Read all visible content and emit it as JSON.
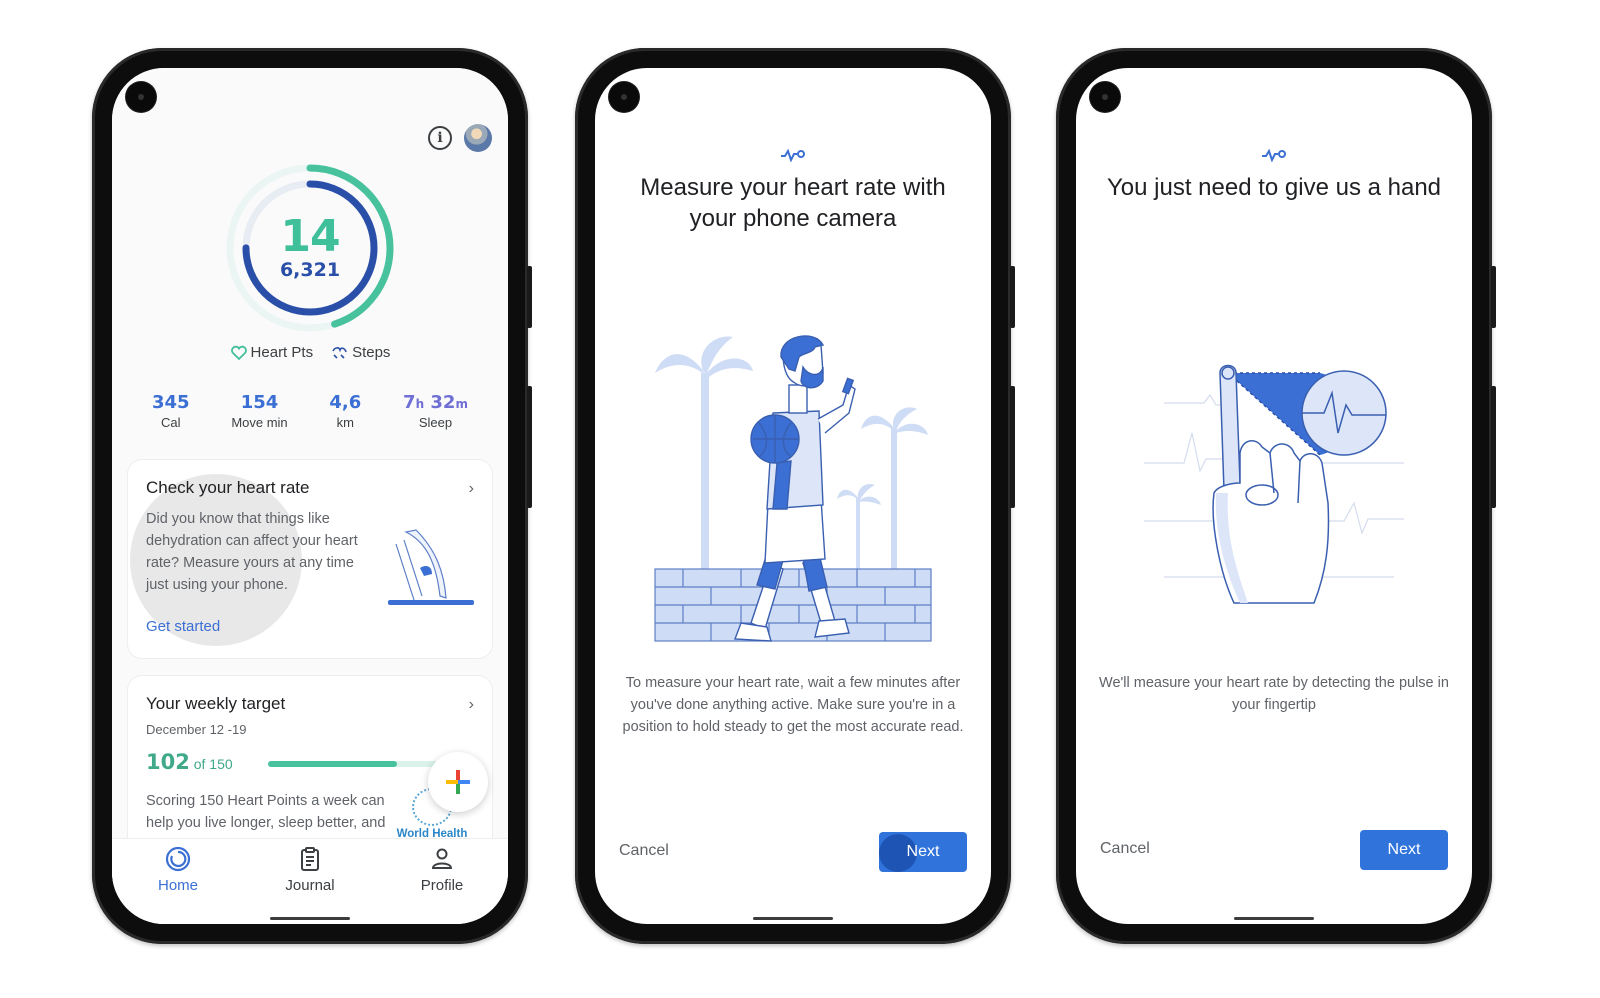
{
  "colors": {
    "heart_pts": "#3fbf9a",
    "steps": "#2a4fa8",
    "accent_blue": "#2f73db",
    "link_blue": "#3b6fd4"
  },
  "phone1": {
    "top_icons": [
      "info-icon",
      "avatar"
    ],
    "rings": {
      "heart_points": 14,
      "steps": "6,321",
      "heart_points_progress": 0.45,
      "steps_progress": 0.75
    },
    "legend": [
      {
        "icon": "heart-icon",
        "label": "Heart Pts"
      },
      {
        "icon": "steps-icon",
        "label": "Steps"
      }
    ],
    "stats": [
      {
        "value": "345",
        "label": "Cal"
      },
      {
        "value": "154",
        "label": "Move min"
      },
      {
        "value": "4,6",
        "label": "km"
      },
      {
        "hours": "7",
        "hours_unit": "h",
        "minutes": "32",
        "minutes_unit": "m",
        "label": "Sleep"
      }
    ],
    "heart_rate_card": {
      "title": "Check your heart rate",
      "body": "Did you know that things like dehydration can affect your heart rate? Measure yours at any time just using your phone.",
      "link": "Get started"
    },
    "weekly_target_card": {
      "title": "Your weekly target",
      "date_range": "December 12 -19",
      "score": "102",
      "score_suffix": "of 150",
      "progress": 0.68,
      "body": "Scoring 150 Heart Points a week can help you live longer, sleep better, and boost your mood",
      "source": "World Health Organization"
    },
    "nav": [
      {
        "icon": "home-icon",
        "label": "Home",
        "active": true
      },
      {
        "icon": "journal-icon",
        "label": "Journal",
        "active": false
      },
      {
        "icon": "profile-icon",
        "label": "Profile",
        "active": false
      }
    ]
  },
  "phone2": {
    "title": "Measure your heart rate with your phone camera",
    "description": "To measure your heart rate, wait a few minutes after you've done anything active. Make sure you're in a position to hold steady to get the most accurate read.",
    "cancel_label": "Cancel",
    "next_label": "Next"
  },
  "phone3": {
    "title": "You just need to give us a hand",
    "description": "We'll measure your heart rate by detecting the pulse in your fingertip",
    "cancel_label": "Cancel",
    "next_label": "Next"
  }
}
